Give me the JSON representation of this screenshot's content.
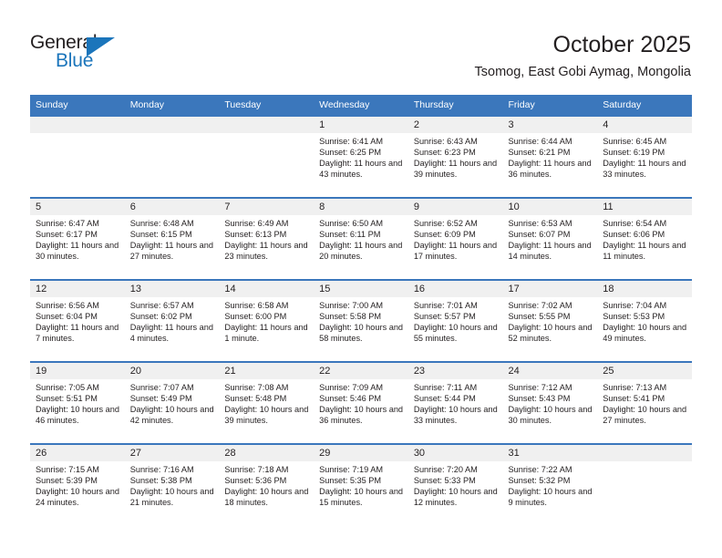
{
  "brand": {
    "line1": "General",
    "line2": "Blue",
    "flag_icon": "triangle-flag-icon",
    "accent_color": "#1b75bb"
  },
  "header": {
    "title": "October 2025",
    "subtitle": "Tsomog, East Gobi Aymag, Mongolia"
  },
  "theme": {
    "header_blue": "#3b77bc",
    "daynum_band": "#f0f0f0",
    "text": "#231f20"
  },
  "calendar": {
    "weekday_headers": [
      "Sunday",
      "Monday",
      "Tuesday",
      "Wednesday",
      "Thursday",
      "Friday",
      "Saturday"
    ],
    "weeks": [
      [
        {
          "day": "",
          "sunrise": "",
          "sunset": "",
          "daylight": "",
          "empty": true
        },
        {
          "day": "",
          "sunrise": "",
          "sunset": "",
          "daylight": "",
          "empty": true
        },
        {
          "day": "",
          "sunrise": "",
          "sunset": "",
          "daylight": "",
          "empty": true
        },
        {
          "day": "1",
          "sunrise": "Sunrise: 6:41 AM",
          "sunset": "Sunset: 6:25 PM",
          "daylight": "Daylight: 11 hours and 43 minutes."
        },
        {
          "day": "2",
          "sunrise": "Sunrise: 6:43 AM",
          "sunset": "Sunset: 6:23 PM",
          "daylight": "Daylight: 11 hours and 39 minutes."
        },
        {
          "day": "3",
          "sunrise": "Sunrise: 6:44 AM",
          "sunset": "Sunset: 6:21 PM",
          "daylight": "Daylight: 11 hours and 36 minutes."
        },
        {
          "day": "4",
          "sunrise": "Sunrise: 6:45 AM",
          "sunset": "Sunset: 6:19 PM",
          "daylight": "Daylight: 11 hours and 33 minutes."
        }
      ],
      [
        {
          "day": "5",
          "sunrise": "Sunrise: 6:47 AM",
          "sunset": "Sunset: 6:17 PM",
          "daylight": "Daylight: 11 hours and 30 minutes."
        },
        {
          "day": "6",
          "sunrise": "Sunrise: 6:48 AM",
          "sunset": "Sunset: 6:15 PM",
          "daylight": "Daylight: 11 hours and 27 minutes."
        },
        {
          "day": "7",
          "sunrise": "Sunrise: 6:49 AM",
          "sunset": "Sunset: 6:13 PM",
          "daylight": "Daylight: 11 hours and 23 minutes."
        },
        {
          "day": "8",
          "sunrise": "Sunrise: 6:50 AM",
          "sunset": "Sunset: 6:11 PM",
          "daylight": "Daylight: 11 hours and 20 minutes."
        },
        {
          "day": "9",
          "sunrise": "Sunrise: 6:52 AM",
          "sunset": "Sunset: 6:09 PM",
          "daylight": "Daylight: 11 hours and 17 minutes."
        },
        {
          "day": "10",
          "sunrise": "Sunrise: 6:53 AM",
          "sunset": "Sunset: 6:07 PM",
          "daylight": "Daylight: 11 hours and 14 minutes."
        },
        {
          "day": "11",
          "sunrise": "Sunrise: 6:54 AM",
          "sunset": "Sunset: 6:06 PM",
          "daylight": "Daylight: 11 hours and 11 minutes."
        }
      ],
      [
        {
          "day": "12",
          "sunrise": "Sunrise: 6:56 AM",
          "sunset": "Sunset: 6:04 PM",
          "daylight": "Daylight: 11 hours and 7 minutes."
        },
        {
          "day": "13",
          "sunrise": "Sunrise: 6:57 AM",
          "sunset": "Sunset: 6:02 PM",
          "daylight": "Daylight: 11 hours and 4 minutes."
        },
        {
          "day": "14",
          "sunrise": "Sunrise: 6:58 AM",
          "sunset": "Sunset: 6:00 PM",
          "daylight": "Daylight: 11 hours and 1 minute."
        },
        {
          "day": "15",
          "sunrise": "Sunrise: 7:00 AM",
          "sunset": "Sunset: 5:58 PM",
          "daylight": "Daylight: 10 hours and 58 minutes."
        },
        {
          "day": "16",
          "sunrise": "Sunrise: 7:01 AM",
          "sunset": "Sunset: 5:57 PM",
          "daylight": "Daylight: 10 hours and 55 minutes."
        },
        {
          "day": "17",
          "sunrise": "Sunrise: 7:02 AM",
          "sunset": "Sunset: 5:55 PM",
          "daylight": "Daylight: 10 hours and 52 minutes."
        },
        {
          "day": "18",
          "sunrise": "Sunrise: 7:04 AM",
          "sunset": "Sunset: 5:53 PM",
          "daylight": "Daylight: 10 hours and 49 minutes."
        }
      ],
      [
        {
          "day": "19",
          "sunrise": "Sunrise: 7:05 AM",
          "sunset": "Sunset: 5:51 PM",
          "daylight": "Daylight: 10 hours and 46 minutes."
        },
        {
          "day": "20",
          "sunrise": "Sunrise: 7:07 AM",
          "sunset": "Sunset: 5:49 PM",
          "daylight": "Daylight: 10 hours and 42 minutes."
        },
        {
          "day": "21",
          "sunrise": "Sunrise: 7:08 AM",
          "sunset": "Sunset: 5:48 PM",
          "daylight": "Daylight: 10 hours and 39 minutes."
        },
        {
          "day": "22",
          "sunrise": "Sunrise: 7:09 AM",
          "sunset": "Sunset: 5:46 PM",
          "daylight": "Daylight: 10 hours and 36 minutes."
        },
        {
          "day": "23",
          "sunrise": "Sunrise: 7:11 AM",
          "sunset": "Sunset: 5:44 PM",
          "daylight": "Daylight: 10 hours and 33 minutes."
        },
        {
          "day": "24",
          "sunrise": "Sunrise: 7:12 AM",
          "sunset": "Sunset: 5:43 PM",
          "daylight": "Daylight: 10 hours and 30 minutes."
        },
        {
          "day": "25",
          "sunrise": "Sunrise: 7:13 AM",
          "sunset": "Sunset: 5:41 PM",
          "daylight": "Daylight: 10 hours and 27 minutes."
        }
      ],
      [
        {
          "day": "26",
          "sunrise": "Sunrise: 7:15 AM",
          "sunset": "Sunset: 5:39 PM",
          "daylight": "Daylight: 10 hours and 24 minutes."
        },
        {
          "day": "27",
          "sunrise": "Sunrise: 7:16 AM",
          "sunset": "Sunset: 5:38 PM",
          "daylight": "Daylight: 10 hours and 21 minutes."
        },
        {
          "day": "28",
          "sunrise": "Sunrise: 7:18 AM",
          "sunset": "Sunset: 5:36 PM",
          "daylight": "Daylight: 10 hours and 18 minutes."
        },
        {
          "day": "29",
          "sunrise": "Sunrise: 7:19 AM",
          "sunset": "Sunset: 5:35 PM",
          "daylight": "Daylight: 10 hours and 15 minutes."
        },
        {
          "day": "30",
          "sunrise": "Sunrise: 7:20 AM",
          "sunset": "Sunset: 5:33 PM",
          "daylight": "Daylight: 10 hours and 12 minutes."
        },
        {
          "day": "31",
          "sunrise": "Sunrise: 7:22 AM",
          "sunset": "Sunset: 5:32 PM",
          "daylight": "Daylight: 10 hours and 9 minutes."
        },
        {
          "day": "",
          "sunrise": "",
          "sunset": "",
          "daylight": "",
          "empty": true
        }
      ]
    ]
  }
}
